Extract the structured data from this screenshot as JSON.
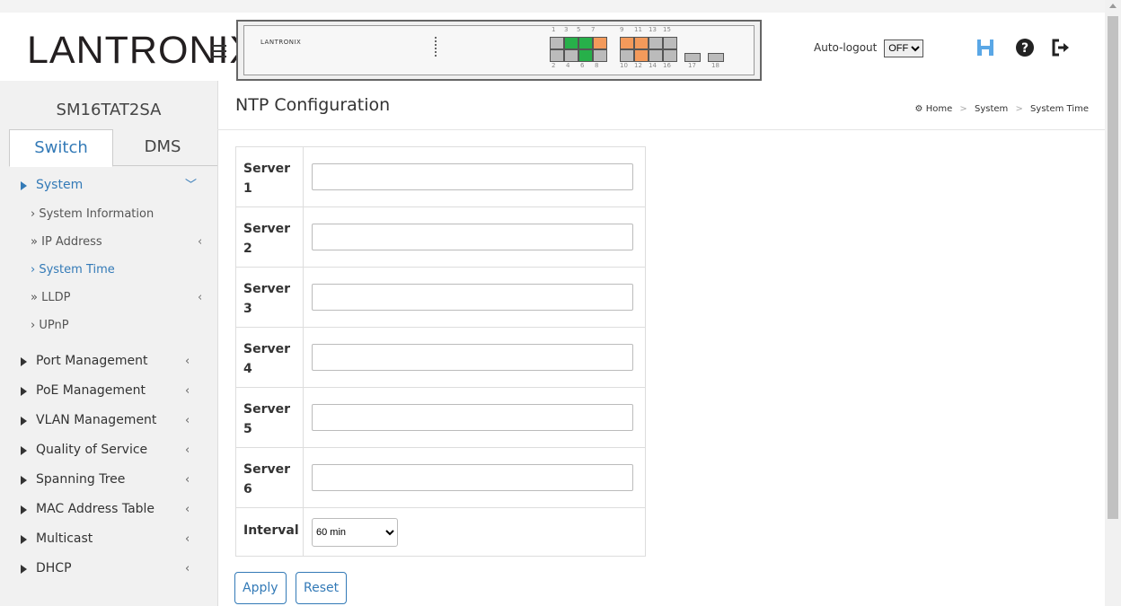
{
  "header": {
    "logo": "LANTRONIX",
    "logo_mark": "®",
    "panel_logo": "LANTRONIX",
    "port_numbers_top": [
      "1",
      "3",
      "5",
      "7",
      "9",
      "11",
      "13",
      "15"
    ],
    "port_numbers_bottom": [
      "2",
      "4",
      "6",
      "8",
      "10",
      "12",
      "14",
      "16",
      "17",
      "18"
    ],
    "auto_logout_label": "Auto-logout",
    "auto_logout_value": "OFF",
    "colors": {
      "accent": "#337ab7",
      "port_green": "#27b04a",
      "port_orange": "#f39a5b"
    },
    "icons": [
      "menu-icon",
      "save-icon",
      "help-icon",
      "logout-icon"
    ]
  },
  "sidebar": {
    "device_name": "SM16TAT2SA",
    "tabs": [
      {
        "label": "Switch"
      },
      {
        "label": "DMS"
      }
    ],
    "menu": {
      "system": "System",
      "system_info": "System Information",
      "ip_address": "IP Address",
      "system_time": "System Time",
      "lldp": "LLDP",
      "upnp": "UPnP",
      "port_management": "Port Management",
      "poe_management": "PoE Management",
      "vlan_management": "VLAN Management",
      "qos": "Quality of Service",
      "spanning_tree": "Spanning Tree",
      "mac_address_table": "MAC Address Table",
      "multicast": "Multicast",
      "dhcp": "DHCP"
    }
  },
  "main": {
    "title": "NTP Configuration",
    "breadcrumb": {
      "home": "Home",
      "section": "System",
      "page": "System Time"
    },
    "servers": [
      {
        "label_a": "Server",
        "label_b": "1",
        "value": ""
      },
      {
        "label_a": "Server",
        "label_b": "2",
        "value": ""
      },
      {
        "label_a": "Server",
        "label_b": "3",
        "value": ""
      },
      {
        "label_a": "Server",
        "label_b": "4",
        "value": ""
      },
      {
        "label_a": "Server",
        "label_b": "5",
        "value": ""
      },
      {
        "label_a": "Server",
        "label_b": "6",
        "value": ""
      }
    ],
    "interval": {
      "label": "Interval",
      "value": "60 min"
    },
    "apply_label": "Apply",
    "reset_label": "Reset"
  }
}
